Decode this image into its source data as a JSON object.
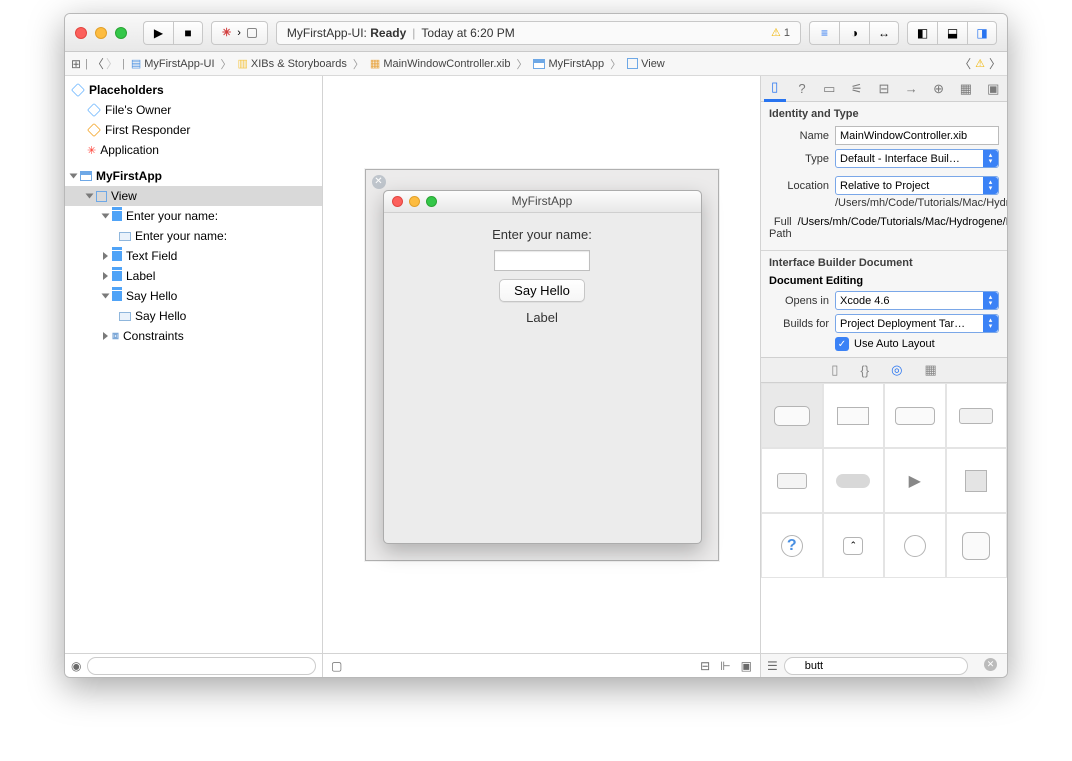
{
  "toolbar": {
    "scheme_icon": "✳",
    "scheme_target": "MyFirstApp-UI",
    "status_prefix": "MyFirstApp-UI: ",
    "status_state": "Ready",
    "status_time": "Today at 6:20 PM",
    "warning_count": "1"
  },
  "breadcrumb": {
    "items": [
      "MyFirstApp-UI",
      "XIBs & Storyboards",
      "MainWindowController.xib",
      "MyFirstApp",
      "View"
    ]
  },
  "outline": {
    "placeholders_header": "Placeholders",
    "files_owner": "File's Owner",
    "first_responder": "First Responder",
    "application": "Application",
    "window": "MyFirstApp",
    "view": "View",
    "enter_name_cell": "Enter your name:",
    "enter_name_label": "Enter your name:",
    "text_field": "Text Field",
    "label": "Label",
    "say_hello_cell": "Say Hello",
    "say_hello_btn": "Say Hello",
    "constraints": "Constraints"
  },
  "ib_window": {
    "title": "MyFirstApp",
    "label1": "Enter your name:",
    "button": "Say Hello",
    "label2": "Label"
  },
  "inspector": {
    "identity_header": "Identity and Type",
    "name_label": "Name",
    "name_value": "MainWindowController.xib",
    "type_label": "Type",
    "type_value": "Default - Interface Buil…",
    "location_label": "Location",
    "location_value": "Relative to Project",
    "location_path": "/Users/mh/Code/Tutorials/Mac/Hydrogene/MyFirstApp/MainWindowController.xib",
    "fullpath_label": "Full Path",
    "fullpath_value": "/Users/mh/Code/Tutorials/Mac/Hydrogene/MyFirstApp/MainWindowController.xib",
    "ibdoc_header": "Interface Builder Document",
    "doc_editing": "Document Editing",
    "opens_label": "Opens in",
    "opens_value": "Xcode 4.6",
    "builds_label": "Builds for",
    "builds_value": "Project Deployment Tar…",
    "auto_layout": "Use Auto Layout"
  },
  "library": {
    "search_value": "butt"
  }
}
